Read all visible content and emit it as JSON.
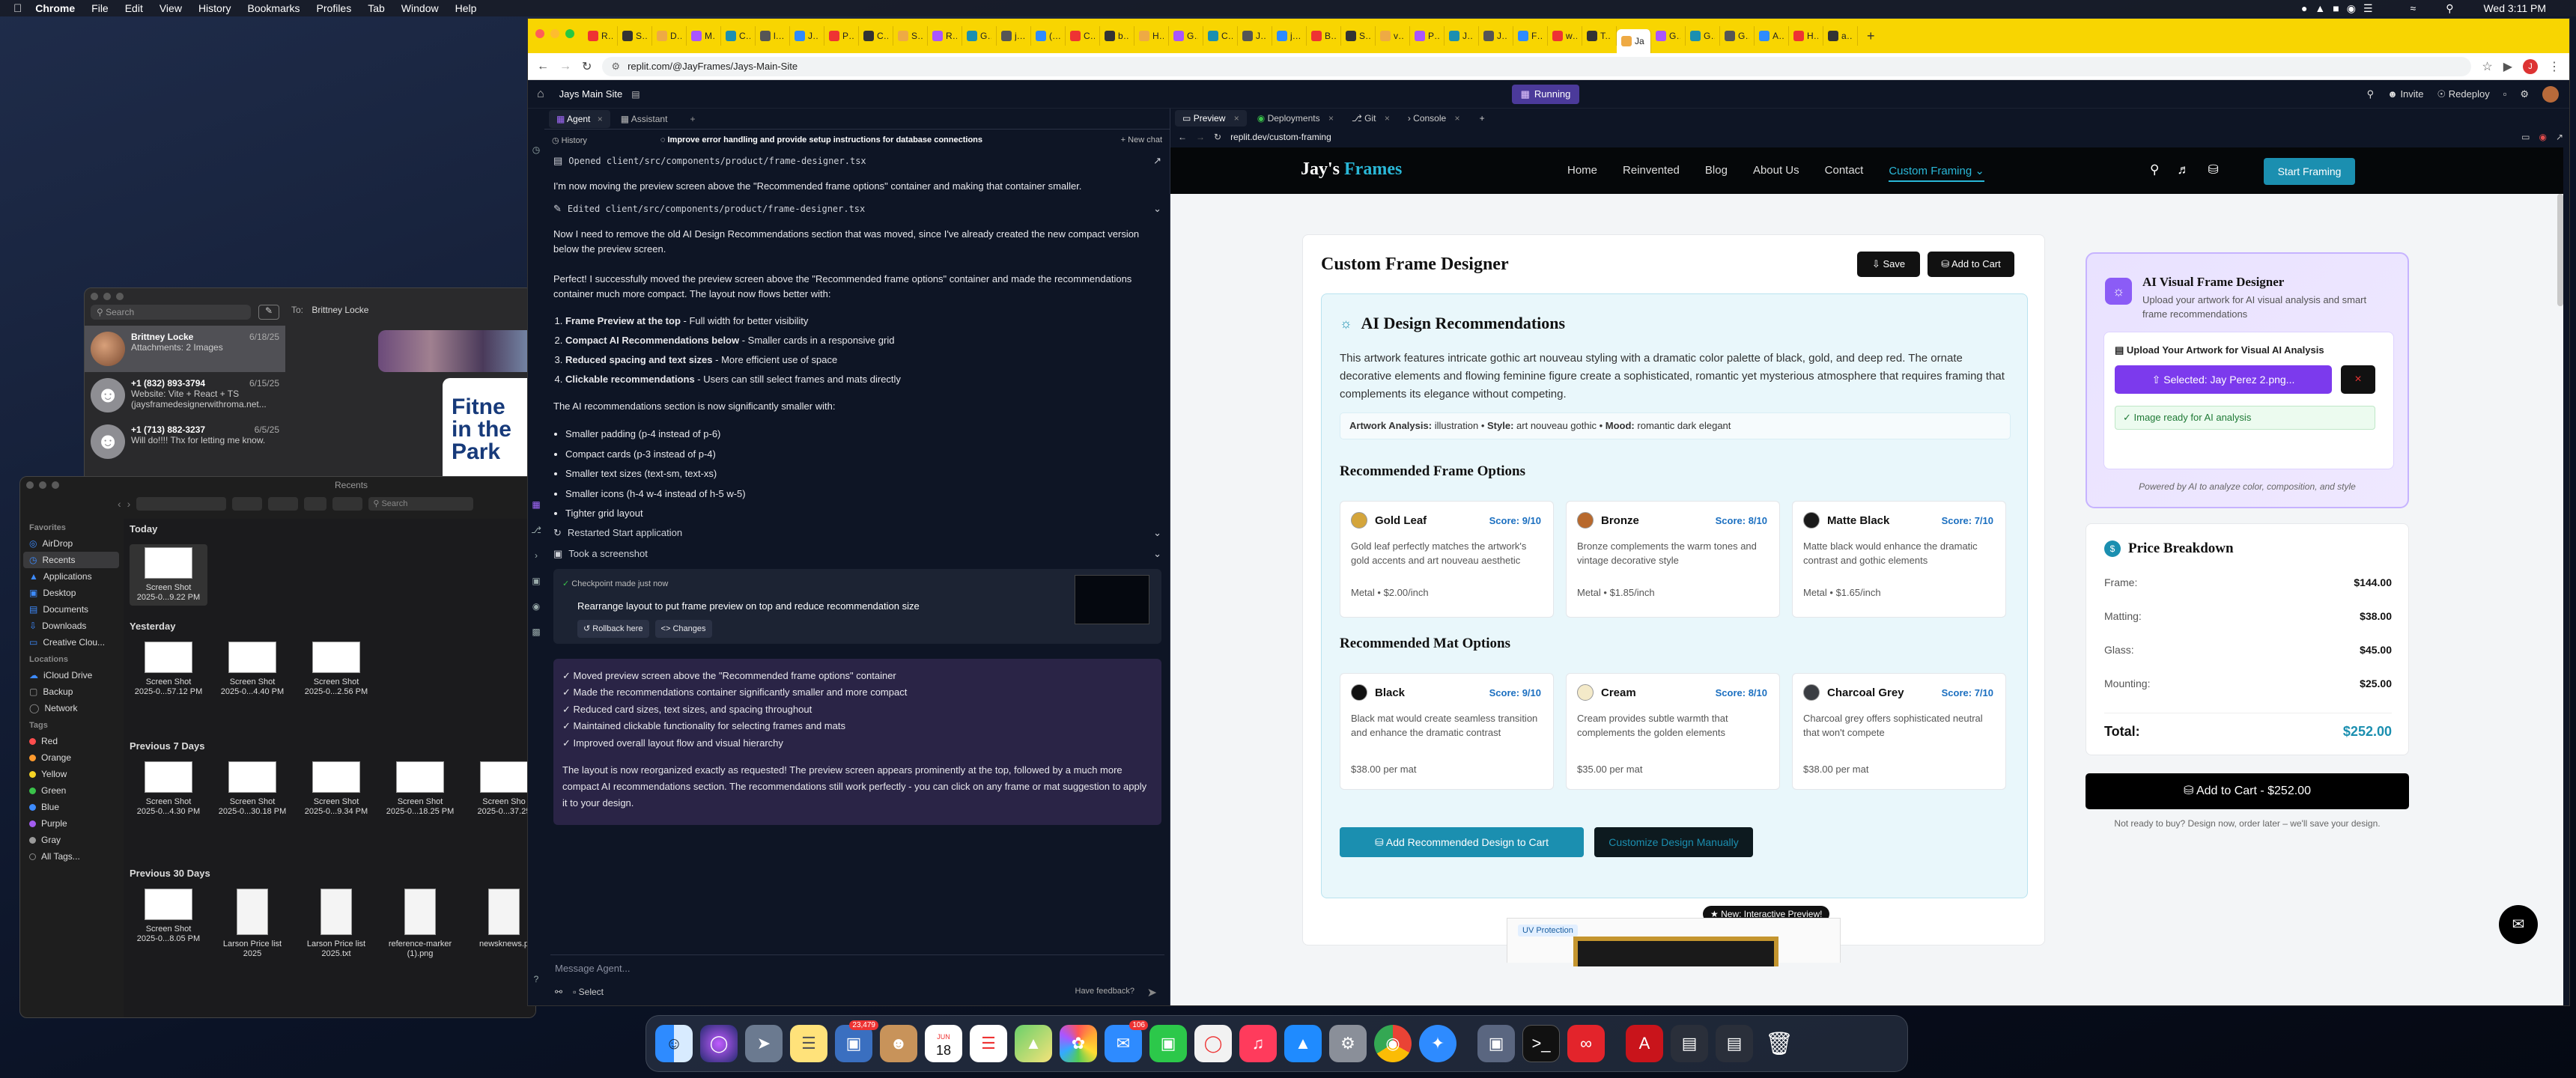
{
  "menubar": {
    "app": "Chrome",
    "items": [
      "File",
      "Edit",
      "View",
      "History",
      "Bookmarks",
      "Profiles",
      "Tab",
      "Window",
      "Help"
    ],
    "clock": "Wed 3:11 PM"
  },
  "messages": {
    "search": "Search",
    "to_label": "To:",
    "to_value": "Brittney Locke",
    "conversations": [
      {
        "name": "Brittney Locke",
        "date": "6/18/25",
        "preview": "Attachments: 2 Images"
      },
      {
        "name": "+1 (832) 893-3794",
        "date": "6/15/25",
        "preview": "Website: Vite + React + TS (jaysframedesignerwithroma.net..."
      },
      {
        "name": "+1 (713) 882-3237",
        "date": "6/5/25",
        "preview": "Will do!!!! Thx for letting me know."
      }
    ],
    "poster_text": "Fitne in the Park"
  },
  "finder": {
    "title": "Recents",
    "search": "Search",
    "sidebar": {
      "favorites_label": "Favorites",
      "favorites": [
        "AirDrop",
        "Recents",
        "Applications",
        "Desktop",
        "Documents",
        "Downloads",
        "Creative Clou..."
      ],
      "locations_label": "Locations",
      "locations": [
        "iCloud Drive",
        "Backup",
        "Network"
      ],
      "tags_label": "Tags",
      "tags": [
        {
          "name": "Red",
          "color": "#ff4d4d"
        },
        {
          "name": "Orange",
          "color": "#ff9a2e"
        },
        {
          "name": "Yellow",
          "color": "#f5d425"
        },
        {
          "name": "Green",
          "color": "#3ac24a"
        },
        {
          "name": "Blue",
          "color": "#3d8bff"
        },
        {
          "name": "Purple",
          "color": "#a35cf0"
        },
        {
          "name": "Gray",
          "color": "#9a9a9a"
        },
        {
          "name": "All Tags...",
          "color": ""
        }
      ]
    },
    "groups": [
      {
        "label": "Today",
        "files": [
          {
            "name": "Screen Shot",
            "date": "2025-0...9.22 PM"
          }
        ]
      },
      {
        "label": "Yesterday",
        "files": [
          {
            "name": "Screen Shot",
            "date": "2025-0...57.12 PM"
          },
          {
            "name": "Screen Shot",
            "date": "2025-0...4.40 PM"
          },
          {
            "name": "Screen Shot",
            "date": "2025-0...2.56 PM"
          }
        ]
      },
      {
        "label": "Previous 7 Days",
        "files": [
          {
            "name": "Screen Shot",
            "date": "2025-0...4.30 PM"
          },
          {
            "name": "Screen Shot",
            "date": "2025-0...30.18 PM"
          },
          {
            "name": "Screen Shot",
            "date": "2025-0...9.34 PM"
          },
          {
            "name": "Screen Shot",
            "date": "2025-0...18.25 PM"
          },
          {
            "name": "Screen Sho",
            "date": "2025-0...37.25"
          }
        ]
      },
      {
        "label": "Previous 30 Days",
        "files": [
          {
            "name": "Screen Shot",
            "date": "2025-0...8.05 PM"
          },
          {
            "name": "Larson Price list",
            "date": "2025"
          },
          {
            "name": "Larson Price list",
            "date": "2025.txt"
          },
          {
            "name": "reference-marker",
            "date": "(1).png"
          },
          {
            "name": "newsknews.p",
            "date": ""
          }
        ]
      }
    ]
  },
  "chrome": {
    "tabs": [
      "Rec",
      "SEO",
      "Depl",
      "Multi",
      "Cust",
      "login",
      "Jay",
      "Prici",
      "Cam",
      "Stab",
      "Runs",
      "Getti",
      "josh:",
      "(Sup",
      "Cust",
      "bolt.",
      "Host",
      "Gene",
      "Con",
      "Jays",
      "josh:",
      "Bam",
      "Strip",
      "virtu",
      "Play",
      "Jays",
      "Jay's",
      "Fram",
      "whai",
      "Telli",
      "Ja",
      "GPT",
      "Getti",
      "Get",
      "Anth",
      "Hom",
      "anth"
    ],
    "active_tab_index": 30,
    "url": "replit.com/@JayFrames/Jays-Main-Site"
  },
  "replit": {
    "project": "Jays Main Site",
    "status": "Running",
    "invite": "Invite",
    "redeploy": "Redeploy",
    "agent_tab": "Agent",
    "assistant_tab": "Assistant",
    "history": "History",
    "thread_title": "Improve error handling and provide setup instructions for database connections",
    "new_chat": "New chat",
    "log": {
      "opened": "Opened client/src/components/product/frame-designer.tsx",
      "p1": "I'm now moving the preview screen above the \"Recommended frame options\" container and making that container smaller.",
      "edited": "Edited client/src/components/product/frame-designer.tsx",
      "p2": "Now I need to remove the old AI Design Recommendations section that was moved, since I've already created the new compact version below the preview screen.",
      "p3": "Perfect! I successfully moved the preview screen above the \"Recommended frame options\" container and made the recommendations container much more compact. The layout now flows better with:",
      "list1": [
        {
          "b": "Frame Preview at the top",
          "r": " - Full width for better visibility"
        },
        {
          "b": "Compact AI Recommendations below",
          "r": " - Smaller cards in a responsive grid"
        },
        {
          "b": "Reduced spacing and text sizes",
          "r": " - More efficient use of space"
        },
        {
          "b": "Clickable recommendations",
          "r": " - Users can still select frames and mats directly"
        }
      ],
      "p4": "The AI recommendations section is now significantly smaller with:",
      "list2": [
        "Smaller padding (p-4 instead of p-6)",
        "Compact cards (p-3 instead of p-4)",
        "Smaller text sizes (text-sm, text-xs)",
        "Smaller icons (h-4 w-4 instead of h-5 w-5)",
        "Tighter grid layout"
      ],
      "restarted": "Restarted Start application",
      "screenshot": "Took a screenshot",
      "checkpoint": "Checkpoint made just now",
      "checkpoint_desc": "Rearrange layout to put frame preview on top and reduce recommendation size",
      "rollback": "Rollback here",
      "changes": "Changes",
      "checks": [
        "Moved preview screen above the \"Recommended frame options\" container",
        "Made the recommendations container significantly smaller and more compact",
        "Reduced card sizes, text sizes, and spacing throughout",
        "Maintained clickable functionality for selecting frames and mats",
        "Improved overall layout flow and visual hierarchy"
      ],
      "summary": "The layout is now reorganized exactly as requested! The preview screen appears prominently at the top, followed by a much more compact AI recommendations section. The recommendations still work perfectly - you can click on any frame or mat suggestion to apply it to your design."
    },
    "composer_placeholder": "Message Agent...",
    "select": "Select",
    "feedback": "Have feedback?",
    "preview_tabs": [
      "Preview",
      "Deployments",
      "Git",
      "Console"
    ],
    "preview_url": "replit.dev/custom-framing"
  },
  "site": {
    "logo_a": "Jay's",
    "logo_b": "Frames",
    "nav": [
      "Home",
      "Reinvented",
      "Blog",
      "About Us",
      "Contact",
      "Custom Framing"
    ],
    "cta": "Start Framing",
    "designer_title": "Custom Frame Designer",
    "save": "Save",
    "add_to_cart": "Add to Cart",
    "ai_title": "AI Design Recommendations",
    "ai_desc": "This artwork features intricate gothic art nouveau styling with a dramatic color palette of black, gold, and deep red. The ornate decorative elements and flowing feminine figure create a sophisticated, romantic yet mysterious atmosphere that requires framing that complements its elegance without competing.",
    "analysis": {
      "a_label": "Artwork Analysis:",
      "a_val": "illustration",
      "s_label": "Style:",
      "s_val": "art nouveau gothic",
      "m_label": "Mood:",
      "m_val": "romantic dark elegant"
    },
    "frames_title": "Recommended Frame Options",
    "frames": [
      {
        "name": "Gold Leaf",
        "score": "Score: 9/10",
        "desc": "Gold leaf perfectly matches the artwork's gold accents and art nouveau aesthetic",
        "price": "Metal • $2.00/inch",
        "color": "#d4a53b"
      },
      {
        "name": "Bronze",
        "score": "Score: 8/10",
        "desc": "Bronze complements the warm tones and vintage decorative style",
        "price": "Metal • $1.85/inch",
        "color": "#b8692d"
      },
      {
        "name": "Matte Black",
        "score": "Score: 7/10",
        "desc": "Matte black would enhance the dramatic contrast and gothic elements",
        "price": "Metal • $1.65/inch",
        "color": "#1a1a1a"
      }
    ],
    "mats_title": "Recommended Mat Options",
    "mats": [
      {
        "name": "Black",
        "score": "Score: 9/10",
        "desc": "Black mat would create seamless transition and enhance the dramatic contrast",
        "price": "$38.00 per mat",
        "color": "#111111"
      },
      {
        "name": "Cream",
        "score": "Score: 8/10",
        "desc": "Cream provides subtle warmth that complements the golden elements",
        "price": "$35.00 per mat",
        "color": "#f4eac9"
      },
      {
        "name": "Charcoal Grey",
        "score": "Score: 7/10",
        "desc": "Charcoal grey offers sophisticated neutral that won't compete",
        "price": "$38.00 per mat",
        "color": "#3a3d42"
      }
    ],
    "add_recommended": "Add Recommended Design to Cart",
    "customize": "Customize Design Manually",
    "new_preview": "New: Interactive Preview!",
    "uv": "UV Protection",
    "visual_title": "AI Visual Frame Designer",
    "visual_desc": "Upload your artwork for AI visual analysis and smart frame recommendations",
    "upload_title": "Upload Your Artwork for Visual AI Analysis",
    "selected": "Selected: Jay Perez 2.png...",
    "ready": "Image ready for AI analysis",
    "powered": "Powered by AI to analyze color, composition, and style",
    "price_title": "Price Breakdown",
    "price_rows": [
      {
        "label": "Frame:",
        "value": "$144.00"
      },
      {
        "label": "Matting:",
        "value": "$38.00"
      },
      {
        "label": "Glass:",
        "value": "$45.00"
      },
      {
        "label": "Mounting:",
        "value": "$25.00"
      }
    ],
    "total_label": "Total:",
    "total_value": "$252.00",
    "cart_total": "Add to Cart - $252.00",
    "not_ready": "Not ready to buy? Design now, order later – we'll save your design."
  },
  "dock": {
    "badge1": "23,479",
    "badge2": "106",
    "calendar_month": "JUN",
    "calendar_day": "18"
  },
  "colors": {
    "teal": "#1b8fb0",
    "yellow_tabs": "#f8d501",
    "replit_bg": "#0e1525"
  }
}
